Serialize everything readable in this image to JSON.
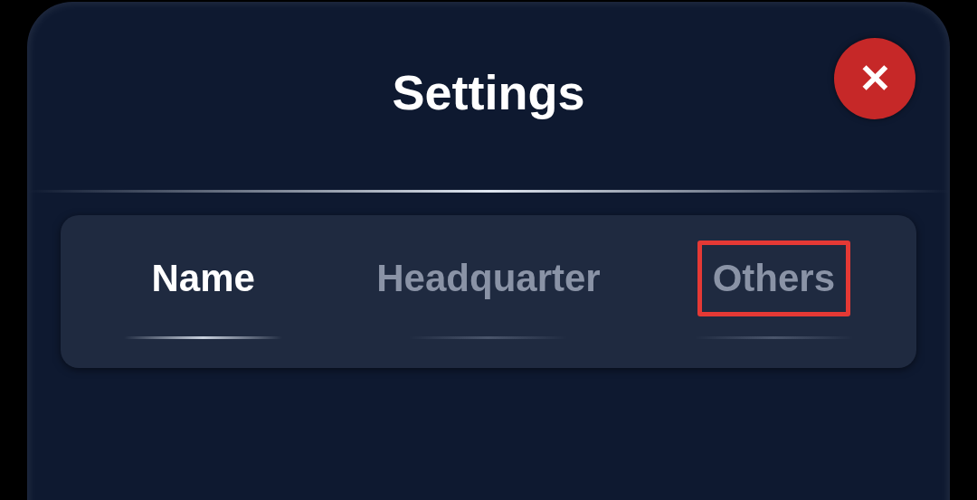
{
  "dialog": {
    "title": "Settings",
    "close_label": "✕"
  },
  "tabs": [
    {
      "label": "Name",
      "selected": true,
      "highlighted": false
    },
    {
      "label": "Headquarter",
      "selected": false,
      "highlighted": false
    },
    {
      "label": "Others",
      "selected": false,
      "highlighted": true
    }
  ]
}
